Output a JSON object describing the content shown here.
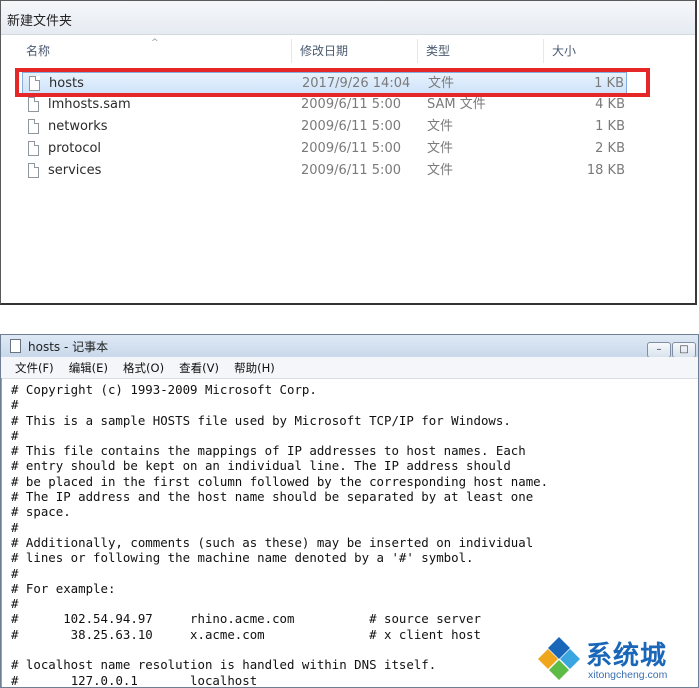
{
  "explorer": {
    "title": "新建文件夹",
    "columns": {
      "name": "名称",
      "date": "修改日期",
      "type": "类型",
      "size": "大小"
    },
    "rows": [
      {
        "name": "hosts",
        "date": "2017/9/26 14:04",
        "type": "文件",
        "size": "1 KB",
        "selected": true
      },
      {
        "name": "lmhosts.sam",
        "date": "2009/6/11 5:00",
        "type": "SAM 文件",
        "size": "4 KB"
      },
      {
        "name": "networks",
        "date": "2009/6/11 5:00",
        "type": "文件",
        "size": "1 KB"
      },
      {
        "name": "protocol",
        "date": "2009/6/11 5:00",
        "type": "文件",
        "size": "2 KB"
      },
      {
        "name": "services",
        "date": "2009/6/11 5:00",
        "type": "文件",
        "size": "18 KB"
      }
    ],
    "highlight_color": "#e62727"
  },
  "notepad": {
    "title": "hosts - 记事本",
    "menu": [
      "文件(F)",
      "编辑(E)",
      "格式(O)",
      "查看(V)",
      "帮助(H)"
    ],
    "text": "# Copyright (c) 1993-2009 Microsoft Corp.\n#\n# This is a sample HOSTS file used by Microsoft TCP/IP for Windows.\n#\n# This file contains the mappings of IP addresses to host names. Each\n# entry should be kept on an individual line. The IP address should\n# be placed in the first column followed by the corresponding host name.\n# The IP address and the host name should be separated by at least one\n# space.\n#\n# Additionally, comments (such as these) may be inserted on individual\n# lines or following the machine name denoted by a '#' symbol.\n#\n# For example:\n#\n#      102.54.94.97     rhino.acme.com          # source server\n#       38.25.63.10     x.acme.com              # x client host\n\n# localhost name resolution is handled within DNS itself.\n#\t127.0.0.1       localhost"
  },
  "logo": {
    "cn": "系统城",
    "en": "xitongcheng.com",
    "color": "#1a66b8"
  }
}
